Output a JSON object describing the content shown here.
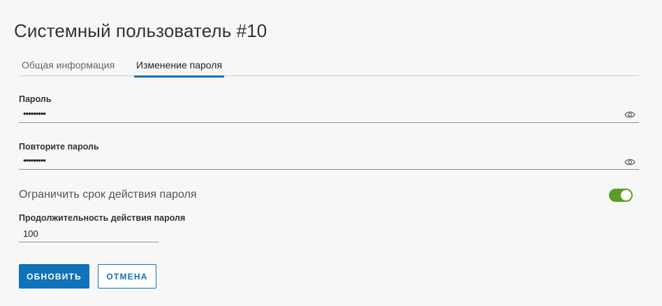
{
  "page": {
    "title": "Системный пользователь #10"
  },
  "tabs": [
    {
      "label": "Общая информация",
      "active": false
    },
    {
      "label": "Изменение пароля",
      "active": true
    }
  ],
  "form": {
    "password": {
      "label": "Пароль",
      "value": "•••••••••",
      "icon": "eye-icon"
    },
    "repeat_password": {
      "label": "Повторите пароль",
      "value": "•••••••••",
      "icon": "eye-icon"
    },
    "limit_validity": {
      "label": "Ограничить срок действия пароля",
      "enabled": true
    },
    "duration": {
      "label": "Продолжительность действия пароля",
      "value": "100"
    }
  },
  "actions": {
    "update_label": "ОБНОВИТЬ",
    "cancel_label": "ОТМЕНА"
  },
  "colors": {
    "accent": "#1072b9",
    "toggle_on": "#5c9c2a",
    "background": "#f7f7f7"
  }
}
